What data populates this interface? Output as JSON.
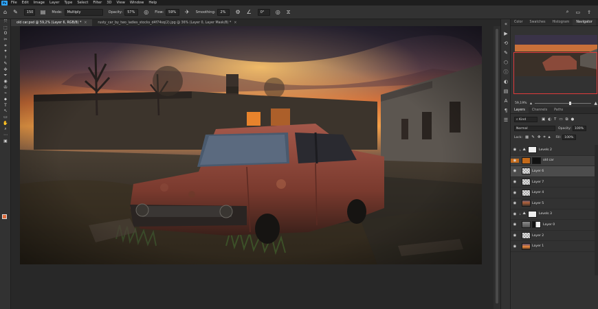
{
  "menubar": {
    "logo": "Ps",
    "items": [
      "File",
      "Edit",
      "Image",
      "Layer",
      "Type",
      "Select",
      "Filter",
      "3D",
      "View",
      "Window",
      "Help"
    ]
  },
  "options": {
    "mode_label": "Mode:",
    "mode_value": "Multiply",
    "opacity_label": "Opacity:",
    "opacity_value": "57%",
    "flow_label": "Flow:",
    "flow_value": "59%",
    "smoothing_label": "Smoothing:",
    "smoothing_value": "2%",
    "angle_value": "0°",
    "brush_size": "150"
  },
  "tabs": [
    {
      "label": "old car.psd @ 59,2% (Layer 6, RGB/8) *",
      "close": "×"
    },
    {
      "label": "rusty_car_by_two_ladies_stocks_d4f74sq(2).jpg @ 36% (Layer 0, Layer Mask/8) *",
      "close": "×"
    }
  ],
  "tools": [
    "⤧",
    "⬚",
    "ʘ",
    "✂",
    "⌗",
    "✦",
    "⚕",
    "✎",
    "✜",
    "⏷",
    "◉",
    "✇",
    "⌁",
    "⬥",
    "T",
    "↖",
    "▭",
    "✋",
    "⌕",
    "⋯",
    "▣"
  ],
  "panel": {
    "top_tabs": [
      "Color",
      "Swatches",
      "Histogram",
      "Navigator"
    ],
    "active_top_tab": "Navigator",
    "zoom_value": "59,19%",
    "layer_tabs": [
      "Layers",
      "Channels",
      "Paths"
    ],
    "active_layer_tab": "Layers",
    "filter_kind": "Kind",
    "blend_mode": "Normal",
    "opacity_label": "Opacity:",
    "opacity_value": "100%",
    "lock_label": "Lock:",
    "fill_label": "Fill:",
    "fill_value": "100%"
  },
  "layers": [
    {
      "name": "Levels 2",
      "type": "adjustment",
      "thumb": "grey",
      "mask": true
    },
    {
      "name": "old car",
      "type": "smart",
      "thumb": "orange",
      "mask": true,
      "selected": false
    },
    {
      "name": "Layer 6",
      "type": "pixel",
      "thumb": "checker",
      "selected": true
    },
    {
      "name": "Layer 7",
      "type": "pixel",
      "thumb": "checker"
    },
    {
      "name": "Layer 4",
      "type": "pixel",
      "thumb": "checker"
    },
    {
      "name": "Layer 5",
      "type": "pixel",
      "thumb": "scene"
    },
    {
      "name": "Levels 3",
      "type": "adjustment",
      "thumb": "grey",
      "mask": true
    },
    {
      "name": "Layer 0",
      "type": "pixel",
      "thumb": "scene",
      "mask": true
    },
    {
      "name": "Layer 2",
      "type": "pixel",
      "thumb": "checker"
    },
    {
      "name": "Layer 1",
      "type": "pixel",
      "thumb": "sky"
    }
  ],
  "colors": {
    "accent": "#31a8ff",
    "nav_frame": "#e23b3b",
    "foreground": "#e06a3a",
    "background": "#1a1a1a"
  }
}
